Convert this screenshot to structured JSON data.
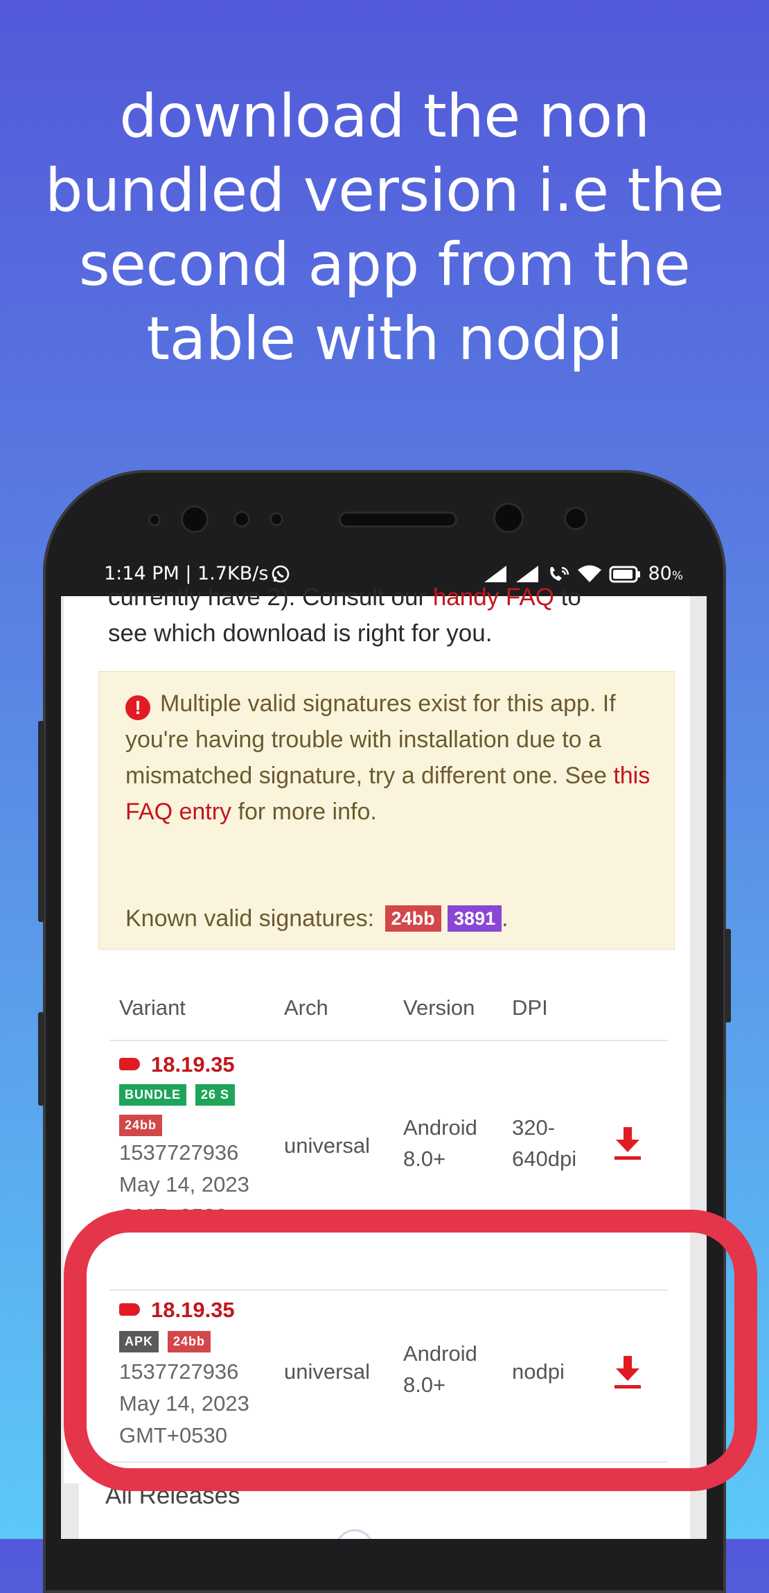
{
  "headline": "download the non bundled version i.e the second app from the table with nodpi",
  "status_bar": {
    "time_speed": "1:14 PM | 1.7KB/s",
    "battery": "80"
  },
  "page": {
    "intro_cut": "currently have 2). Consult our ",
    "intro_cut_link": "handy FAQ",
    "intro_cut_end": " to",
    "intro_line2": "see which download is right for you.",
    "warning": {
      "text_before_link": "Multiple valid signatures exist for this app. If you're having trouble with installation due to a mismatched signature, try a different one. See ",
      "link": "this FAQ entry",
      "text_after_link": " for more info.",
      "signatures_label": "Known valid signatures:",
      "signatures": [
        "24bb",
        "3891"
      ],
      "signature_colors": [
        "#d2474a",
        "#8a46d4"
      ]
    },
    "table": {
      "headers": [
        "Variant",
        "Arch",
        "Version",
        "DPI"
      ],
      "rows": [
        {
          "version": "18.19.35",
          "tags": [
            "BUNDLE",
            "26 S"
          ],
          "sig": "24bb",
          "build": "1537727936",
          "date": "May 14, 2023",
          "tz": "GMT+0530",
          "arch": "universal",
          "min_version_1": "Android",
          "min_version_2": "8.0+",
          "dpi_1": "320-",
          "dpi_2": "640dpi"
        },
        {
          "version": "18.19.35",
          "tags": [
            "APK"
          ],
          "sig": "24bb",
          "build": "1537727936",
          "date": "May 14, 2023",
          "tz": "GMT+0530",
          "arch": "universal",
          "min_version_1": "Android",
          "min_version_2": "8.0+",
          "dpi_1": "nodpi",
          "dpi_2": ""
        }
      ]
    },
    "all_releases": "All Releases"
  },
  "colors": {
    "accent_red": "#c3151d",
    "highlight_ring": "#e5354a",
    "bundle_green": "#1ea55a",
    "apk_gray": "#5a5a5a"
  }
}
